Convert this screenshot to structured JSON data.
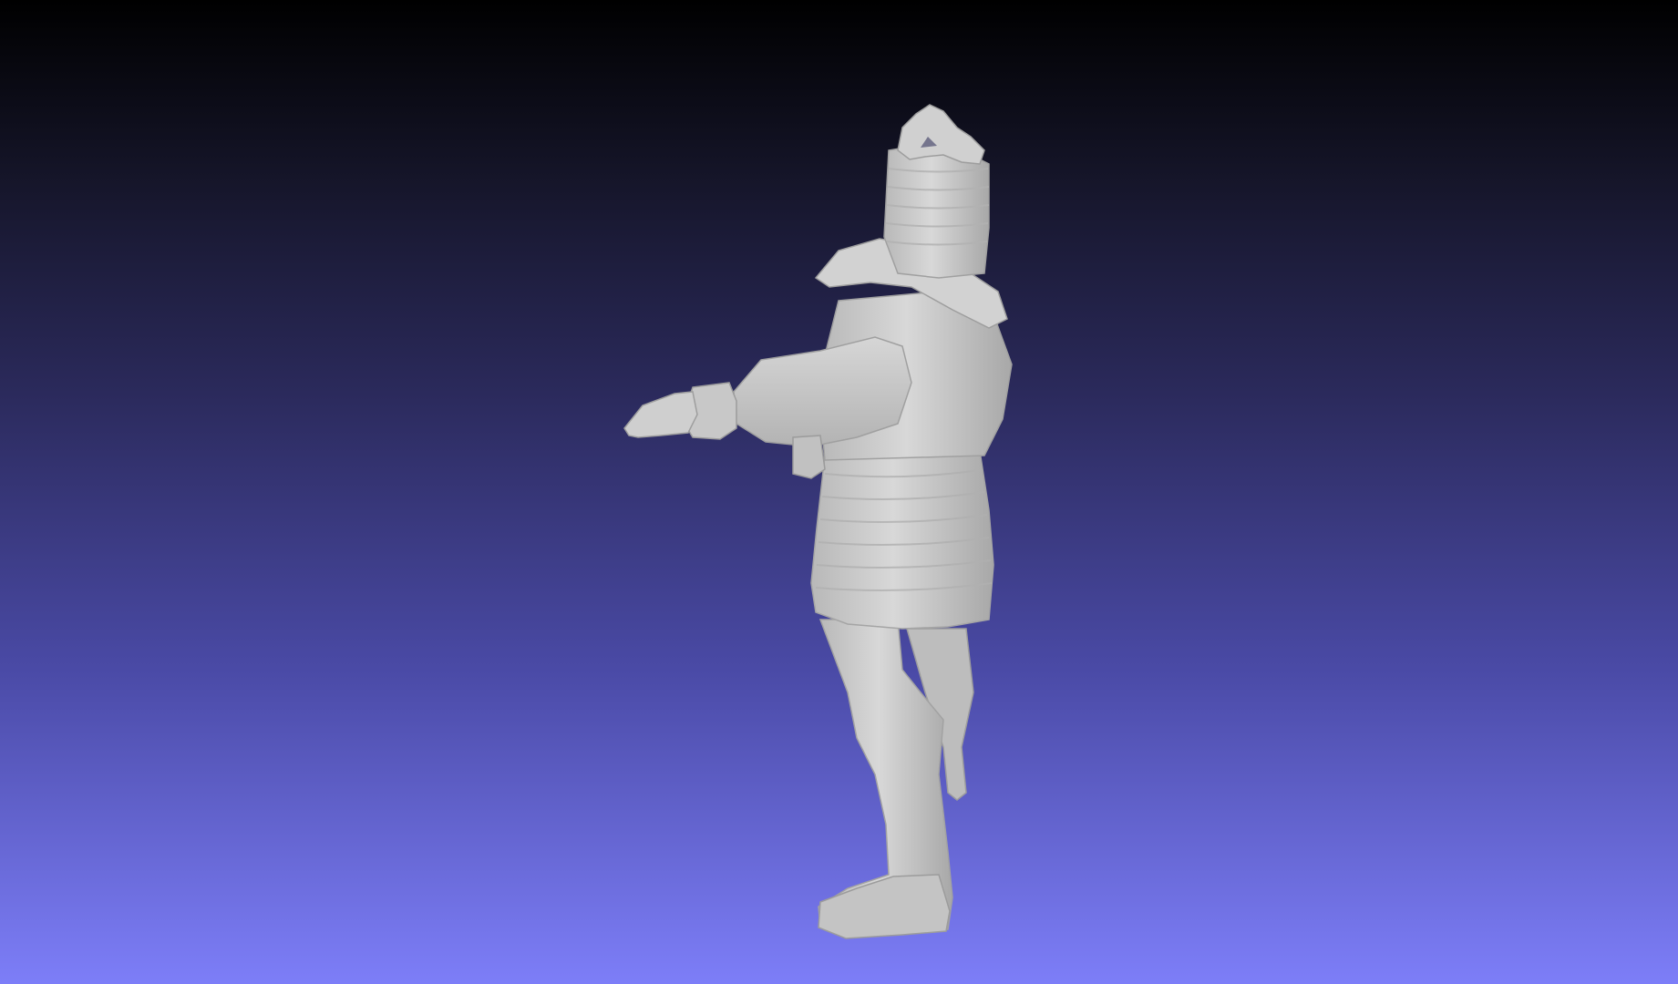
{
  "viewer": {
    "background_top": "#000000",
    "background_bottom": "#7d7ef8",
    "model_color": "#c9c9c9",
    "model_shade": "#a9a9a9",
    "model_highlight": "#e8e8e8",
    "model_icon": "armored-figure-mesh"
  }
}
